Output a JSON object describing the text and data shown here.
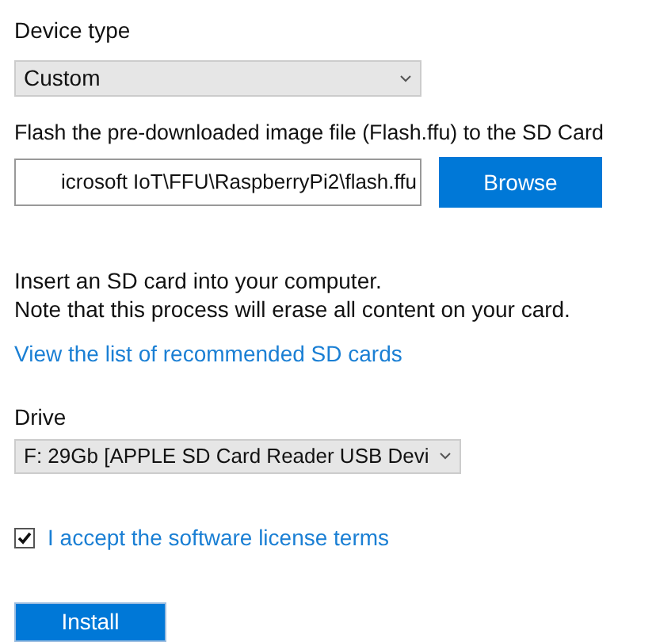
{
  "device_type": {
    "label": "Device type",
    "value": "Custom"
  },
  "flash": {
    "label": "Flash the pre-downloaded image file (Flash.ffu) to the SD Card",
    "path": "icrosoft IoT\\FFU\\RaspberryPi2\\flash.ffu",
    "browse_button": "Browse"
  },
  "instructions": [
    "Insert an SD card into your computer.",
    "Note that this process will erase all content on your card."
  ],
  "sd_cards_link": "View the list of recommended SD cards",
  "drive": {
    "label": "Drive",
    "value": "F: 29Gb [APPLE SD Card Reader USB Devi"
  },
  "license": {
    "label": "I accept the software license terms",
    "checked": true
  },
  "install_button": "Install"
}
